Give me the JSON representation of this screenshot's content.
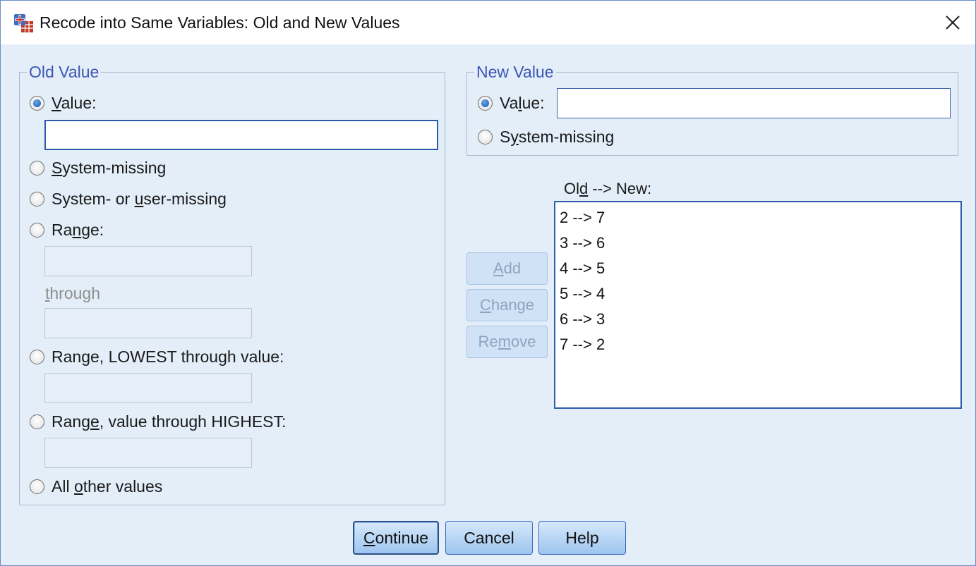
{
  "window": {
    "title": "Recode into Same Variables: Old and New Values"
  },
  "old_value": {
    "legend": "Old Value",
    "value_label": "Value:",
    "value_input": "",
    "system_missing": "System-missing",
    "system_or_user_missing": "System- or user-missing",
    "range": "Range:",
    "range_from": "",
    "through": "through",
    "range_to": "",
    "range_lowest": "Range, LOWEST through value:",
    "range_lowest_input": "",
    "range_highest": "Range, value through HIGHEST:",
    "range_highest_input": "",
    "all_other": "All other values",
    "selected": "Value:"
  },
  "new_value": {
    "legend": "New Value",
    "value_label": "Value:",
    "value_input": "",
    "system_missing": "System-missing",
    "selected": "Value:"
  },
  "mapping": {
    "label": "Old --> New:",
    "items": [
      "2 --> 7",
      "3 --> 6",
      "4 --> 5",
      "5 --> 4",
      "6 --> 3",
      "7 --> 2"
    ]
  },
  "side_buttons": {
    "add": "Add",
    "change": "Change",
    "remove": "Remove"
  },
  "footer": {
    "continue": "Continue",
    "cancel": "Cancel",
    "help": "Help"
  },
  "icons": {
    "app": "spss-recode-icon",
    "close": "close-icon"
  }
}
